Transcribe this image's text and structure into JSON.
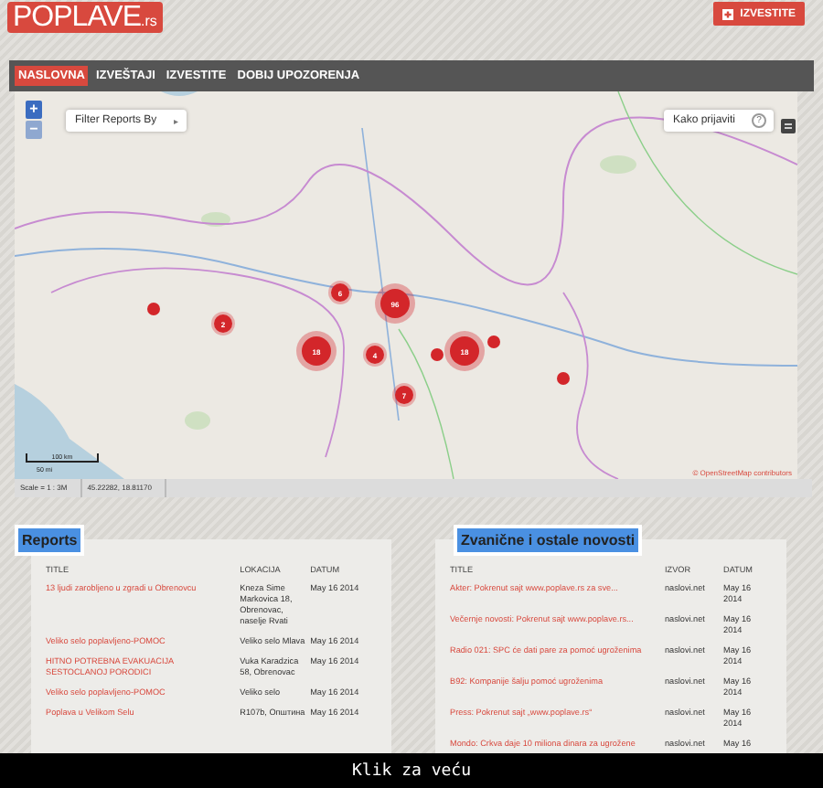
{
  "logo": {
    "name": "POPLAVE",
    "suffix": ".rs"
  },
  "report_button": {
    "label": "IZVESTITE"
  },
  "nav": [
    {
      "label": "NASLOVNA",
      "selected": true
    },
    {
      "label": "IZVEŠTAJI",
      "selected": false
    },
    {
      "label": "IZVESTITE",
      "selected": false
    },
    {
      "label": "DOBIJ UPOZORENJA",
      "selected": false
    }
  ],
  "map": {
    "zoom_in": "+",
    "zoom_out": "−",
    "filter": {
      "label": "Filter Reports By",
      "arrow": "▸"
    },
    "help": {
      "label": "Kako prijaviti",
      "icon": "?"
    },
    "attribution": "© OpenStreetMap contributors",
    "scale_bar": [
      "100 km",
      "50 mi"
    ],
    "markers": [
      {
        "kind": "point"
      },
      {
        "kind": "cluster",
        "count": "2"
      },
      {
        "kind": "cluster",
        "count": "6"
      },
      {
        "kind": "big",
        "count": "96"
      },
      {
        "kind": "big",
        "count": "18"
      },
      {
        "kind": "cluster",
        "count": "4"
      },
      {
        "kind": "point"
      },
      {
        "kind": "big",
        "count": "18"
      },
      {
        "kind": "point"
      },
      {
        "kind": "cluster",
        "count": "7"
      },
      {
        "kind": "point"
      }
    ]
  },
  "status_bar": {
    "scale": "Scale = 1 : 3M",
    "coordinates": "45.22282, 18.81170"
  },
  "reports": {
    "title": "Reports",
    "columns": [
      "TITLE",
      "LOKACIJA",
      "DATUM"
    ],
    "rows": [
      {
        "title": "13 ljudi zarobljeno u zgradi u Obrenovcu",
        "location": "Kneza Sime Markovica 18, Obrenovac, naselje Rvati",
        "date": "May 16 2014"
      },
      {
        "title": "Veliko selo poplavljeno-POMOC",
        "location": "Veliko selo Mlava",
        "date": "May 16 2014"
      },
      {
        "title": "HITNO POTREBNA EVAKUACIJA SESTOCLANOJ PORODICI",
        "location": "Vuka Karadzica 58, Obrenovac",
        "date": "May 16 2014"
      },
      {
        "title": "Veliko selo poplavljeno-POMOC",
        "location": "Veliko selo",
        "date": "May 16 2014"
      },
      {
        "title": "Poplava u Velikom Selu",
        "location": "R107b, Општина",
        "date": "May 16 2014"
      }
    ]
  },
  "news": {
    "title": "Zvanične i ostale novosti",
    "columns": [
      "TITLE",
      "IZVOR",
      "DATUM"
    ],
    "rows": [
      {
        "title": "Akter: Pokrenut sajt www.poplave.rs za sve...",
        "source": "naslovi.net",
        "date": "May 16 2014"
      },
      {
        "title": "Večernje novosti: Pokrenut sajt www.poplave.rs...",
        "source": "naslovi.net",
        "date": "May 16 2014"
      },
      {
        "title": "Radio 021: SPC će dati pare za pomoć ugroženima",
        "source": "naslovi.net",
        "date": "May 16 2014"
      },
      {
        "title": "B92: Kompanije šalju pomoć ugroženima",
        "source": "naslovi.net",
        "date": "May 16 2014"
      },
      {
        "title": "Press: Pokrenut sajt „www.poplave.rs“",
        "source": "naslovi.net",
        "date": "May 16 2014"
      },
      {
        "title": "Mondo: Crkva daje 10 miliona dinara za ugrožene",
        "source": "naslovi.net",
        "date": "May 16"
      }
    ]
  },
  "caption": "Klik za veću"
}
